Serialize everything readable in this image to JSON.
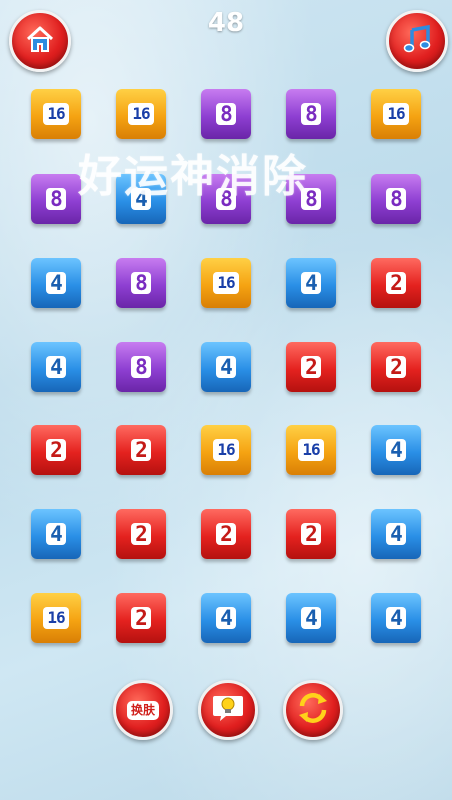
{
  "score": "48",
  "watermark": "好运神消除",
  "skin_button_label": "换肤",
  "icons": {
    "home": "home-icon",
    "music": "music-note-icon",
    "hint": "lightbulb-hint-icon",
    "refresh": "refresh-arrows-icon"
  },
  "colors": {
    "2": "#e4221f",
    "4": "#2a8fe6",
    "8": "#8e3fd2",
    "16": "#f5a312"
  },
  "grid": [
    [
      "16",
      "16",
      "8",
      "8",
      "16"
    ],
    [
      "8",
      "4",
      "8",
      "8",
      "8"
    ],
    [
      "4",
      "8",
      "16",
      "4",
      "2"
    ],
    [
      "4",
      "8",
      "4",
      "2",
      "2"
    ],
    [
      "2",
      "2",
      "16",
      "16",
      "4"
    ],
    [
      "4",
      "2",
      "2",
      "2",
      "4"
    ],
    [
      "16",
      "2",
      "4",
      "4",
      "4"
    ]
  ]
}
